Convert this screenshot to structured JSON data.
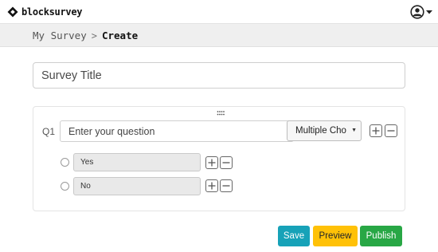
{
  "header": {
    "logo_text": "blocksurvey",
    "logo_icon": "blocksurvey-diamond-logo",
    "user_menu_icon": "user-circle-icon"
  },
  "breadcrumb": {
    "parent": "My Survey",
    "separator": ">",
    "current": "Create"
  },
  "survey": {
    "title_placeholder": "Survey Title"
  },
  "question": {
    "label": "Q1",
    "placeholder": "Enter your question",
    "type_selected": "Multiple Choice",
    "type_visible": "Multiple Cho",
    "options": [
      {
        "value": "Yes"
      },
      {
        "value": "No"
      }
    ]
  },
  "actions": {
    "save": "Save",
    "preview": "Preview",
    "publish": "Publish"
  },
  "colors": {
    "save": "#17a2b8",
    "preview": "#ffc107",
    "publish": "#28a745",
    "breadcrumb_bar": "#efefef"
  }
}
